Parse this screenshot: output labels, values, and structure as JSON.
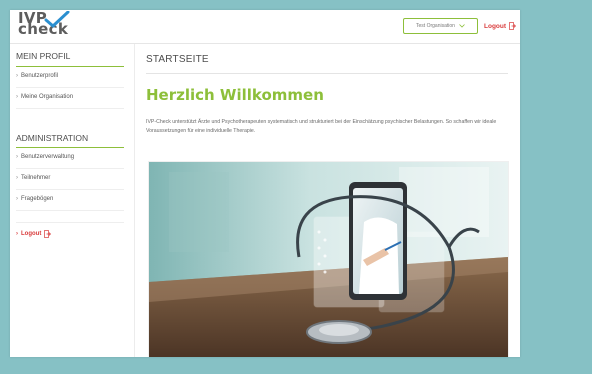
{
  "header": {
    "logo_line1": "IVP",
    "logo_line2": "check",
    "org_select_value": "Test Organisation",
    "logout_label": "Logout"
  },
  "sidebar": {
    "profile_heading": "MEIN PROFIL",
    "profile_items": [
      {
        "label": "Benutzerprofil"
      },
      {
        "label": "Meine Organisation"
      }
    ],
    "admin_heading": "ADMINISTRATION",
    "admin_items": [
      {
        "label": "Benutzerverwaltung"
      },
      {
        "label": "Teilnehmer"
      },
      {
        "label": "Fragebögen"
      }
    ],
    "logout_label": "Logout"
  },
  "main": {
    "page_title": "STARTSEITE",
    "welcome_heading": "Herzlich Willkommen",
    "intro_text": "IVP-Check unterstützt Ärzte und Psychotherapeuten systematisch und strukturiert bei der Einschätzung psychischer Belastungen. So schaffen wir ideale Voraussetzungen für eine individuelle Therapie."
  },
  "colors": {
    "brand_green": "#8dbf3a",
    "logout_red": "#d93b3b",
    "page_background": "#86c1c5"
  },
  "icons": {
    "logo_check": "checkmark-icon",
    "select_chevron": "chevron-down-icon",
    "logout": "logout-icon"
  }
}
